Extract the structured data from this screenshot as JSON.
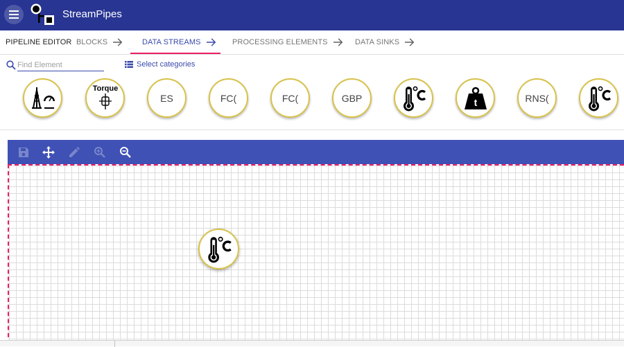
{
  "app": {
    "title": "StreamPipes"
  },
  "icons": {
    "menu": "hamburger-menu-icon",
    "logo": "streampipes-logo-icon",
    "arrow": "arrow-right-icon",
    "search": "search-icon",
    "categories": "list-icon",
    "save": "save-icon",
    "pan": "move-icon",
    "edit": "pencil-icon",
    "zoom_in": "zoom-in-icon",
    "zoom_out": "zoom-out-icon"
  },
  "colors": {
    "header": "#283593",
    "accent": "#3949ab",
    "toolbar": "#3f51b5",
    "tab_indicator": "#e91e63",
    "element_border": "#d8c24a"
  },
  "tabs": {
    "first": "PIPELINE EDITOR",
    "items": [
      {
        "label": "BLOCKS",
        "active": false
      },
      {
        "label": "DATA STREAMS",
        "active": true
      },
      {
        "label": "PROCESSING ELEMENTS",
        "active": false
      },
      {
        "label": "DATA SINKS",
        "active": false
      }
    ]
  },
  "search": {
    "placeholder": "Find Element",
    "value": ""
  },
  "categories": {
    "label": "Select categories"
  },
  "elements": [
    {
      "type": "icon",
      "icon": "drill-rig-icon"
    },
    {
      "type": "icon",
      "icon": "torque-icon",
      "label": "Torque"
    },
    {
      "type": "text",
      "label": "ES"
    },
    {
      "type": "text",
      "label": "FC("
    },
    {
      "type": "text",
      "label": "FC("
    },
    {
      "type": "text",
      "label": "GBP"
    },
    {
      "type": "icon",
      "icon": "thermometer-celsius-icon"
    },
    {
      "type": "icon",
      "icon": "weight-icon",
      "label": "t"
    },
    {
      "type": "text",
      "label": "RNS("
    },
    {
      "type": "icon",
      "icon": "thermometer-celsius-icon"
    }
  ],
  "canvas": {
    "nodes": [
      {
        "icon": "thermometer-celsius-icon"
      }
    ]
  }
}
